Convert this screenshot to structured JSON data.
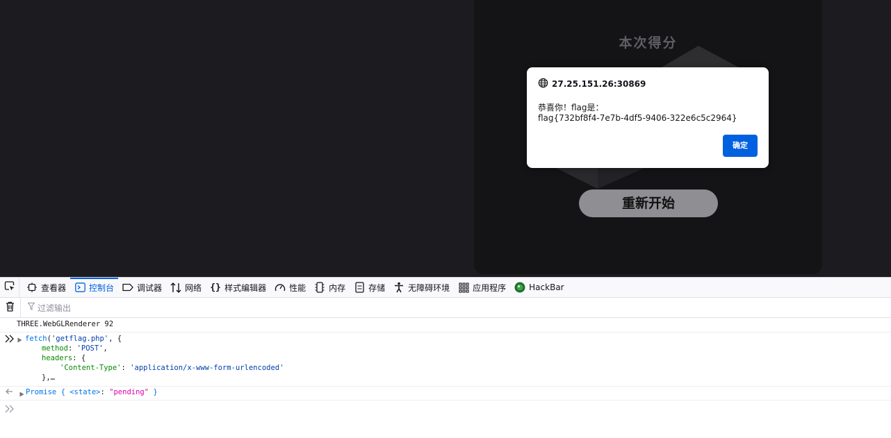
{
  "game": {
    "score_title": "本次得分",
    "restart_label": "重新开始"
  },
  "alert": {
    "origin": "27.25.151.26:30869",
    "message": "恭喜你！flag是：\nflag{732bf8f4-7e7b-4df5-9406-322e6c5c2964}",
    "ok_label": "确定"
  },
  "devtools": {
    "tabs": [
      {
        "label": "查看器",
        "icon": "inspector-icon"
      },
      {
        "label": "控制台",
        "icon": "console-icon",
        "active": true
      },
      {
        "label": "调试器",
        "icon": "debugger-icon"
      },
      {
        "label": "网络",
        "icon": "network-icon"
      },
      {
        "label": "样式编辑器",
        "icon": "style-editor-icon"
      },
      {
        "label": "性能",
        "icon": "performance-icon"
      },
      {
        "label": "内存",
        "icon": "memory-icon"
      },
      {
        "label": "存储",
        "icon": "storage-icon"
      },
      {
        "label": "无障碍环境",
        "icon": "accessibility-icon"
      },
      {
        "label": "应用程序",
        "icon": "application-icon"
      },
      {
        "label": "HackBar",
        "icon": "hackbar-icon"
      }
    ],
    "filter_placeholder": "过滤输出",
    "console": {
      "log": "THREE.WebGLRenderer 92",
      "input": {
        "fn": "fetch",
        "url": "'getflag.php'",
        "method_key": "method",
        "method_val": "'POST'",
        "headers_key": "headers",
        "ct_key": "'Content-Type'",
        "ct_val": "'application/x-www-form-urlencoded'",
        "ellipsis": "},…"
      },
      "result": {
        "type": "Promise",
        "state_key": "<state>",
        "state_val": "\"pending\""
      }
    }
  },
  "colors": {
    "accent": "#0061e0",
    "page_bg": "#1c1b20",
    "panel_bg": "#141416"
  }
}
